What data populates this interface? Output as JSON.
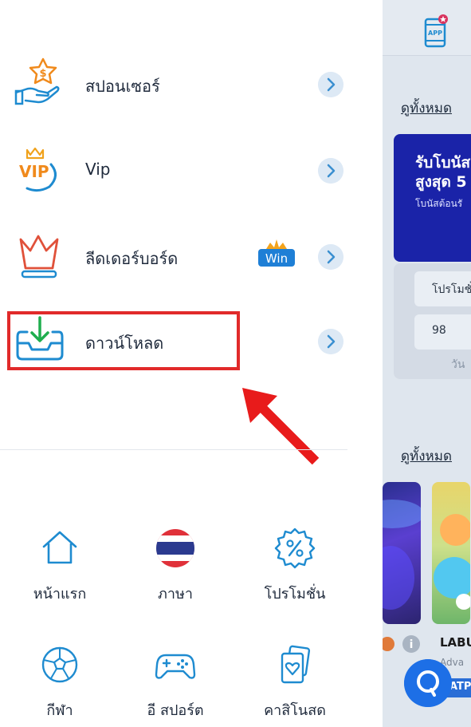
{
  "colors": {
    "accent": "#1e8bd0",
    "highlight_border": "#e12a2a",
    "arrow_bg": "#dde9f5",
    "promo_blue": "#1a23a8",
    "chat_blue": "#1d6fe6"
  },
  "background_page": {
    "app_badge": "APP",
    "see_all_1": "ดูทั้งหมด",
    "see_all_2": "ดูทั้งหมด",
    "promo_title_line1": "รับโบนัส",
    "promo_title_line2": "สูงสุด 5",
    "promo_subtitle": "โบนัสต้อนรั",
    "promo_label": "โปรโมชั่",
    "promo_days_value": "98",
    "promo_days_unit": "วัน",
    "game_title": "LABU",
    "game_provider": "Adva",
    "game_badge": "ATP"
  },
  "drawer": {
    "menu": [
      {
        "label": "สปอนเซอร์",
        "icon": "sponsor-hand-coin-icon"
      },
      {
        "label": "Vip",
        "icon": "vip-crown-icon"
      },
      {
        "label": "ลีดเดอร์บอร์ด",
        "icon": "leaderboard-crown-icon",
        "badge": "Win"
      },
      {
        "label": "ดาวน์โหลด",
        "icon": "download-tray-icon"
      }
    ],
    "grid": [
      {
        "label": "หน้าแรก",
        "icon": "home-icon"
      },
      {
        "label": "ภาษา",
        "icon": "thai-flag-icon"
      },
      {
        "label": "โปรโมชั่น",
        "icon": "promotion-percent-icon"
      },
      {
        "label": "กีฬา",
        "icon": "soccer-ball-icon"
      },
      {
        "label": "อี สปอร์ต",
        "icon": "gamepad-icon"
      },
      {
        "label": "คาสิโนสด",
        "icon": "playing-cards-icon"
      }
    ]
  }
}
